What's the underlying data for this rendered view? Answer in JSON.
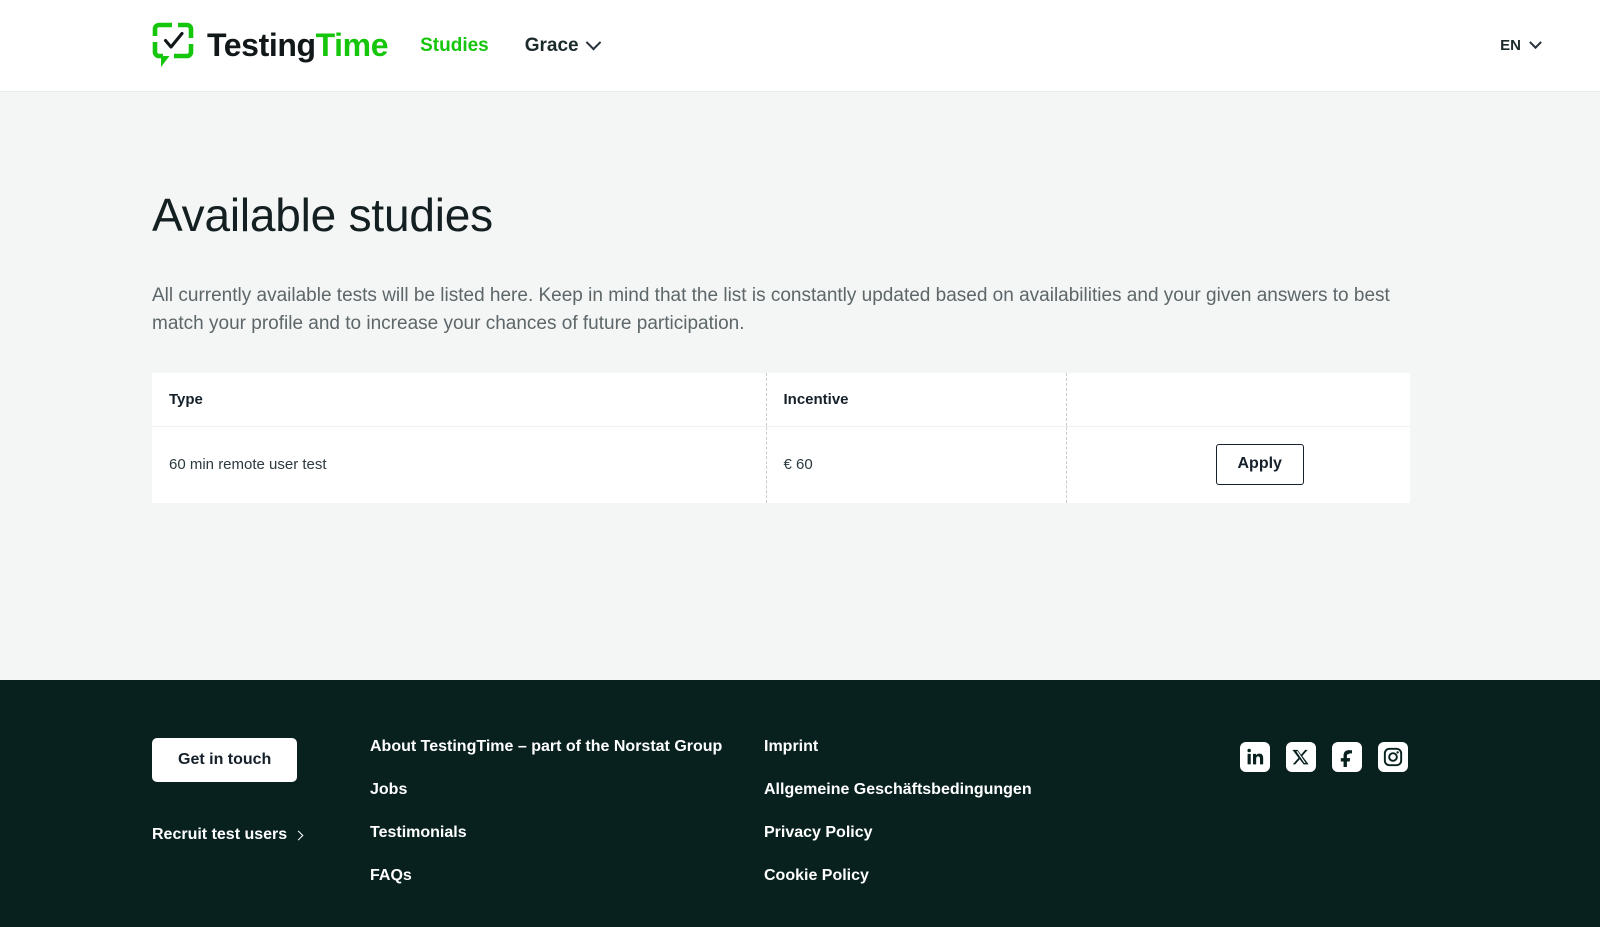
{
  "header": {
    "brand": {
      "name_part1": "Testing",
      "name_part2": "Time",
      "logo_icon": "speech-bubble-check-icon"
    },
    "nav": [
      {
        "label": "Studies",
        "active": true
      },
      {
        "label": "Grace",
        "active": false,
        "has_dropdown": true
      }
    ],
    "language": {
      "label": "EN",
      "icon": "chevron-down-icon"
    }
  },
  "main": {
    "title": "Available studies",
    "intro": "All currently available tests will be listed here. Keep in mind that the list is constantly updated based on availabilities and your given answers to best match your profile and to increase your chances of future participation.",
    "table": {
      "columns": [
        "Type",
        "Incentive",
        ""
      ],
      "rows": [
        {
          "type": "60 min remote user test",
          "incentive": "€ 60",
          "action_label": "Apply"
        }
      ]
    }
  },
  "footer": {
    "cta": {
      "button_label": "Get in touch",
      "recruit_label": "Recruit test users",
      "recruit_icon": "chevron-right-icon"
    },
    "column_one": [
      "About TestingTime – part of the Norstat Group",
      "Jobs",
      "Testimonials",
      "FAQs"
    ],
    "column_two": [
      "Imprint",
      "Allgemeine Geschäftsbedingungen",
      "Privacy Policy",
      "Cookie Policy"
    ],
    "socials": [
      {
        "name": "linkedin-icon"
      },
      {
        "name": "x-twitter-icon"
      },
      {
        "name": "facebook-icon"
      },
      {
        "name": "instagram-icon"
      }
    ]
  },
  "colors": {
    "brand_green": "#16c60c",
    "footer_bg": "#08211f",
    "page_bg": "#f4f5f5"
  }
}
